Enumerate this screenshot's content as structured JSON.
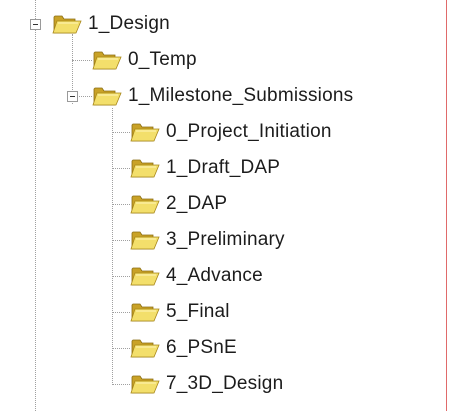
{
  "tree": {
    "root": {
      "label": "1_Design",
      "expander": "minus",
      "icon": "open-folder-icon"
    },
    "children": [
      {
        "label": "0_Temp",
        "icon": "open-folder-icon"
      },
      {
        "label": "1_Milestone_Submissions",
        "expander": "minus",
        "icon": "open-folder-icon",
        "children": [
          {
            "label": "0_Project_Initiation",
            "icon": "open-folder-icon"
          },
          {
            "label": "1_Draft_DAP",
            "icon": "open-folder-icon"
          },
          {
            "label": "2_DAP",
            "icon": "open-folder-icon"
          },
          {
            "label": "3_Preliminary",
            "icon": "open-folder-icon"
          },
          {
            "label": "4_Advance",
            "icon": "open-folder-icon"
          },
          {
            "label": "5_Final",
            "icon": "open-folder-icon"
          },
          {
            "label": "6_PSnE",
            "icon": "open-folder-icon"
          },
          {
            "label": "7_3D_Design",
            "icon": "open-folder-icon"
          }
        ]
      }
    ]
  },
  "colors": {
    "folder_back": "#c9a227",
    "folder_front": "#f3df6b",
    "tree_lines": "#a0a0a0",
    "window_border": "#e06a6a"
  }
}
